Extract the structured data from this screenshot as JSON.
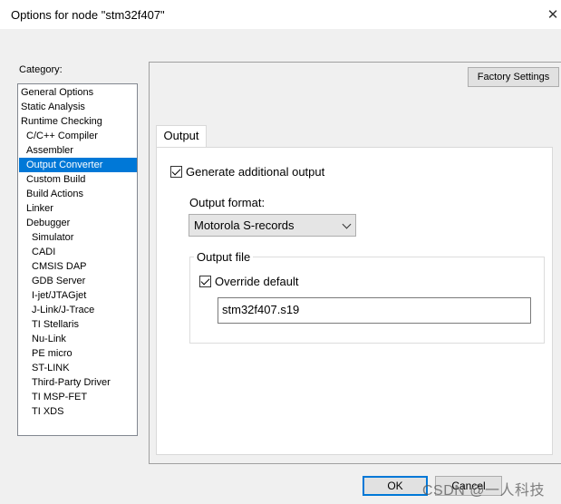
{
  "window": {
    "title": "Options for node \"stm32f407\"",
    "close_icon": "close-icon"
  },
  "category": {
    "label": "Category:",
    "items": [
      {
        "label": "General Options",
        "indent": 0,
        "selected": false
      },
      {
        "label": "Static Analysis",
        "indent": 0,
        "selected": false
      },
      {
        "label": "Runtime Checking",
        "indent": 0,
        "selected": false
      },
      {
        "label": "C/C++ Compiler",
        "indent": 1,
        "selected": false
      },
      {
        "label": "Assembler",
        "indent": 1,
        "selected": false
      },
      {
        "label": "Output Converter",
        "indent": 1,
        "selected": true
      },
      {
        "label": "Custom Build",
        "indent": 1,
        "selected": false
      },
      {
        "label": "Build Actions",
        "indent": 1,
        "selected": false
      },
      {
        "label": "Linker",
        "indent": 1,
        "selected": false
      },
      {
        "label": "Debugger",
        "indent": 1,
        "selected": false
      },
      {
        "label": "Simulator",
        "indent": 2,
        "selected": false
      },
      {
        "label": "CADI",
        "indent": 2,
        "selected": false
      },
      {
        "label": "CMSIS DAP",
        "indent": 2,
        "selected": false
      },
      {
        "label": "GDB Server",
        "indent": 2,
        "selected": false
      },
      {
        "label": "I-jet/JTAGjet",
        "indent": 2,
        "selected": false
      },
      {
        "label": "J-Link/J-Trace",
        "indent": 2,
        "selected": false
      },
      {
        "label": "TI Stellaris",
        "indent": 2,
        "selected": false
      },
      {
        "label": "Nu-Link",
        "indent": 2,
        "selected": false
      },
      {
        "label": "PE micro",
        "indent": 2,
        "selected": false
      },
      {
        "label": "ST-LINK",
        "indent": 2,
        "selected": false
      },
      {
        "label": "Third-Party Driver",
        "indent": 2,
        "selected": false
      },
      {
        "label": "TI MSP-FET",
        "indent": 2,
        "selected": false
      },
      {
        "label": "TI XDS",
        "indent": 2,
        "selected": false
      }
    ]
  },
  "toolbar": {
    "factory_settings_label": "Factory Settings"
  },
  "tabs": [
    {
      "label": "Output",
      "active": true
    }
  ],
  "output": {
    "generate_additional_output_label": "Generate additional output",
    "generate_additional_output_checked": true,
    "output_format_label": "Output format:",
    "output_format_value": "Motorola S-records",
    "output_file_group_label": "Output file",
    "override_default_label": "Override default",
    "override_default_checked": true,
    "output_file_value": "stm32f407.s19"
  },
  "buttons": {
    "ok_label": "OK",
    "cancel_label": "Cancel"
  },
  "watermark": {
    "text": "CSDN @一人科技"
  },
  "colors": {
    "selection": "#0078d7",
    "dialog_background": "#f0f0f0"
  }
}
